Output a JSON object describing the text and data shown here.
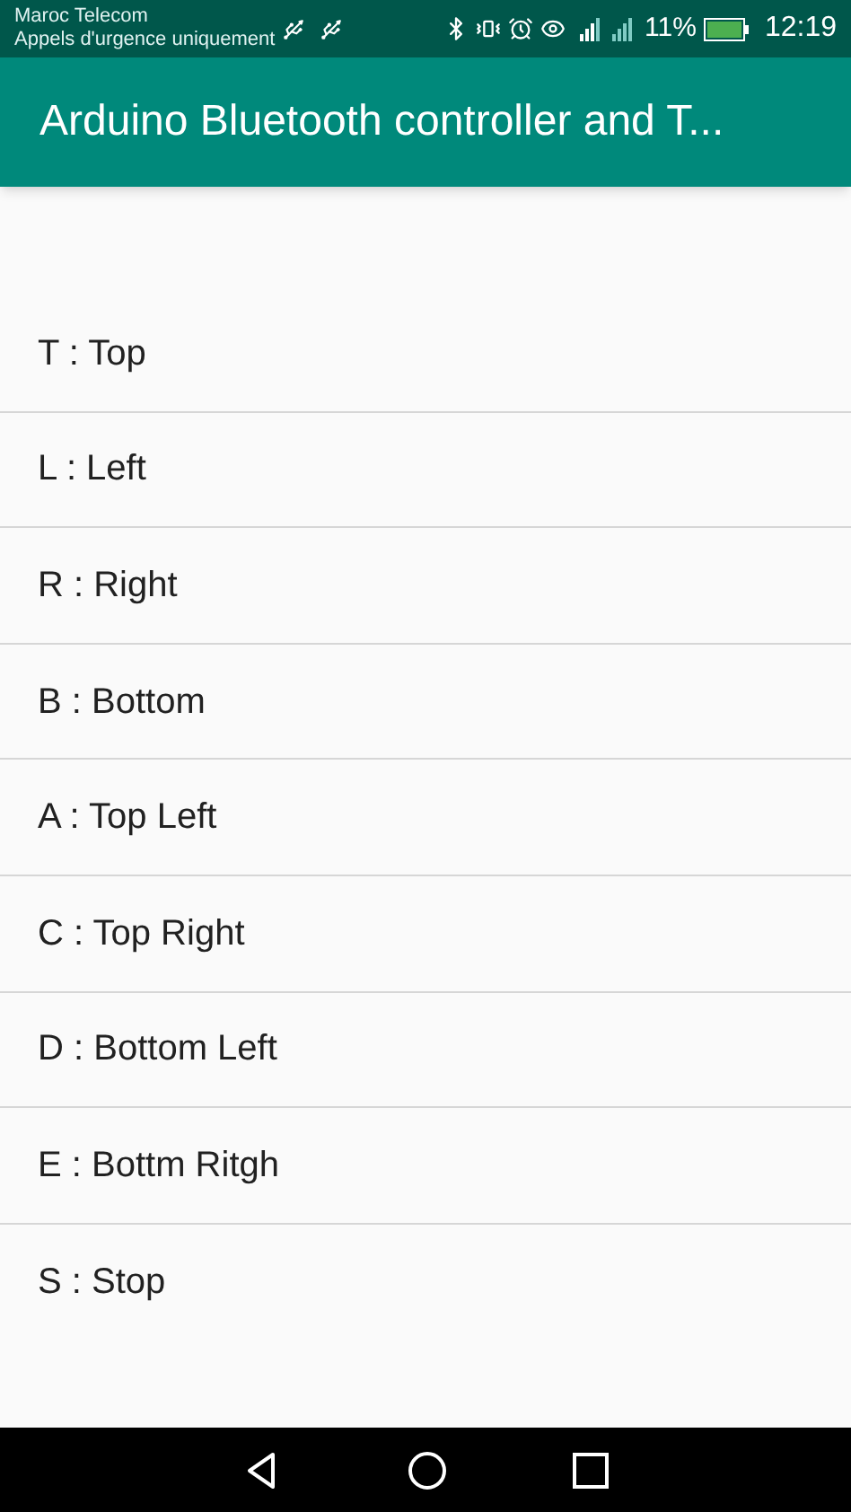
{
  "status_bar": {
    "carrier": "Maroc Telecom",
    "emergency": "Appels d'urgence uniquement",
    "battery": "11%",
    "time": "12:19"
  },
  "app_bar": {
    "title": "Arduino Bluetooth controller and T..."
  },
  "commands": [
    {
      "label": "T : Top"
    },
    {
      "label": "L : Left"
    },
    {
      "label": "R : Right"
    },
    {
      "label": "B : Bottom"
    },
    {
      "label": "A : Top Left"
    },
    {
      "label": "C : Top Right"
    },
    {
      "label": "D : Bottom Left"
    },
    {
      "label": "E : Bottm Ritgh"
    },
    {
      "label": "S : Stop"
    }
  ]
}
